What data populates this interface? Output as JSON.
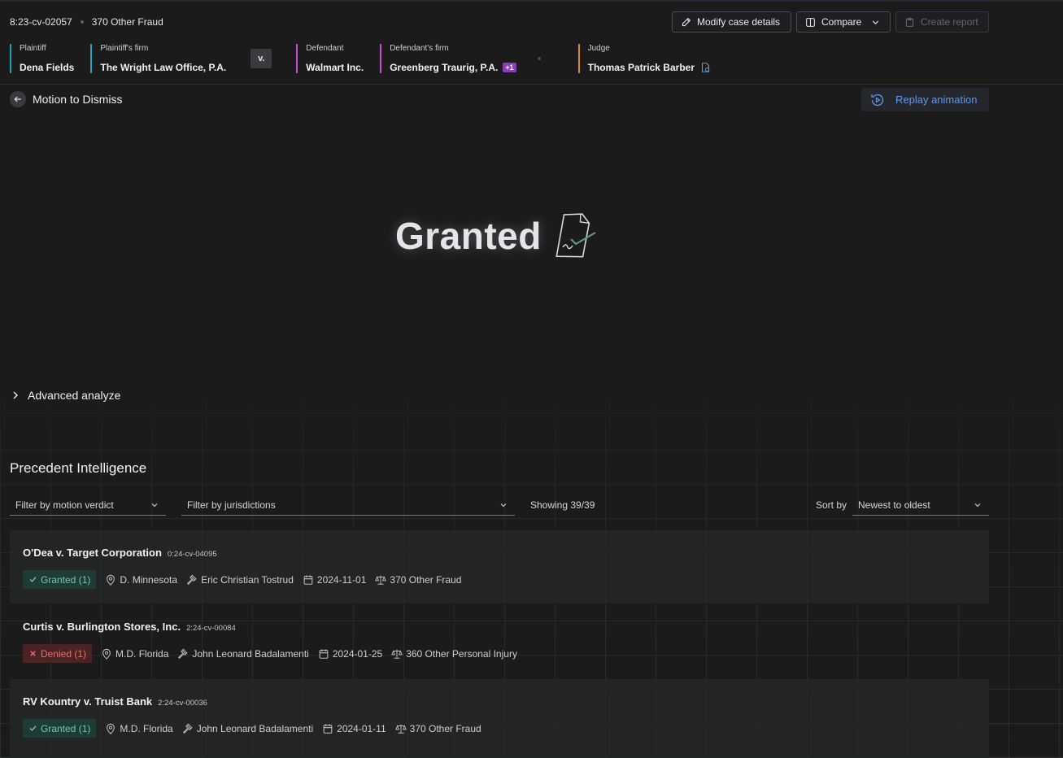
{
  "header": {
    "case_number": "8:23-cv-02057",
    "case_type": "370 Other Fraud",
    "buttons": {
      "modify": "Modify case details",
      "compare": "Compare",
      "create_report": "Create report"
    },
    "parties": {
      "plaintiff_label": "Plaintiff",
      "plaintiff": "Dena Fields",
      "plaintiff_firm_label": "Plaintiff's firm",
      "plaintiff_firm": "The Wright Law Office, P.A.",
      "vs": "v.",
      "defendant_label": "Defendant",
      "defendant": "Walmart Inc.",
      "defendant_firm_label": "Defendant's firm",
      "defendant_firm": "Greenberg Traurig, P.A.",
      "defendant_firm_extra": "+1",
      "judge_label": "Judge",
      "judge": "Thomas Patrick Barber"
    }
  },
  "subheader": {
    "back_title": "Motion to Dismiss",
    "replay_label": "Replay animation"
  },
  "hero": {
    "verdict": "Granted"
  },
  "advanced": {
    "label": "Advanced analyze"
  },
  "precedent": {
    "title": "Precedent Intelligence",
    "filter_verdict_placeholder": "Filter by motion verdict",
    "filter_jurisdiction_placeholder": "Filter by jurisdictions",
    "showing": "Showing 39/39",
    "sort_label": "Sort by",
    "sort_value": "Newest to oldest",
    "cases": [
      {
        "title": "O'Dea v. Target Corporation",
        "docket": "0:24-cv-04095",
        "verdict": "Granted (1)",
        "court": "D. Minnesota",
        "judge": "Eric Christian Tostrud",
        "date": "2024-11-01",
        "nature": "370 Other Fraud"
      },
      {
        "title": "Curtis v. Burlington Stores, Inc.",
        "docket": "2:24-cv-00084",
        "verdict": "Denied (1)",
        "court": "M.D. Florida",
        "judge": "John Leonard Badalamenti",
        "date": "2024-01-25",
        "nature": "360 Other Personal Injury"
      },
      {
        "title": "RV Kountry v. Truist Bank",
        "docket": "2:24-cv-00036",
        "verdict": "Granted (1)",
        "court": "M.D. Florida",
        "judge": "John Leonard Badalamenti",
        "date": "2024-01-11",
        "nature": "370 Other Fraud"
      }
    ]
  },
  "colors": {
    "plaintiff_accent": "#1ea2b8",
    "defendant_accent": "#c451c9",
    "judge_accent": "#d98b2b",
    "replay_blue": "#5f97ef",
    "granted_green": "#76c8a9",
    "denied_red": "#e8706e"
  },
  "icons": [
    "pencil-icon",
    "compare-icon",
    "chevron-down-icon",
    "clipboard-icon",
    "back-arrow-icon",
    "replay-icon",
    "document-check-icon",
    "chevron-right-icon",
    "check-icon",
    "x-icon",
    "location-pin-icon",
    "gavel-icon",
    "calendar-icon",
    "scales-icon",
    "judge-info-icon"
  ]
}
